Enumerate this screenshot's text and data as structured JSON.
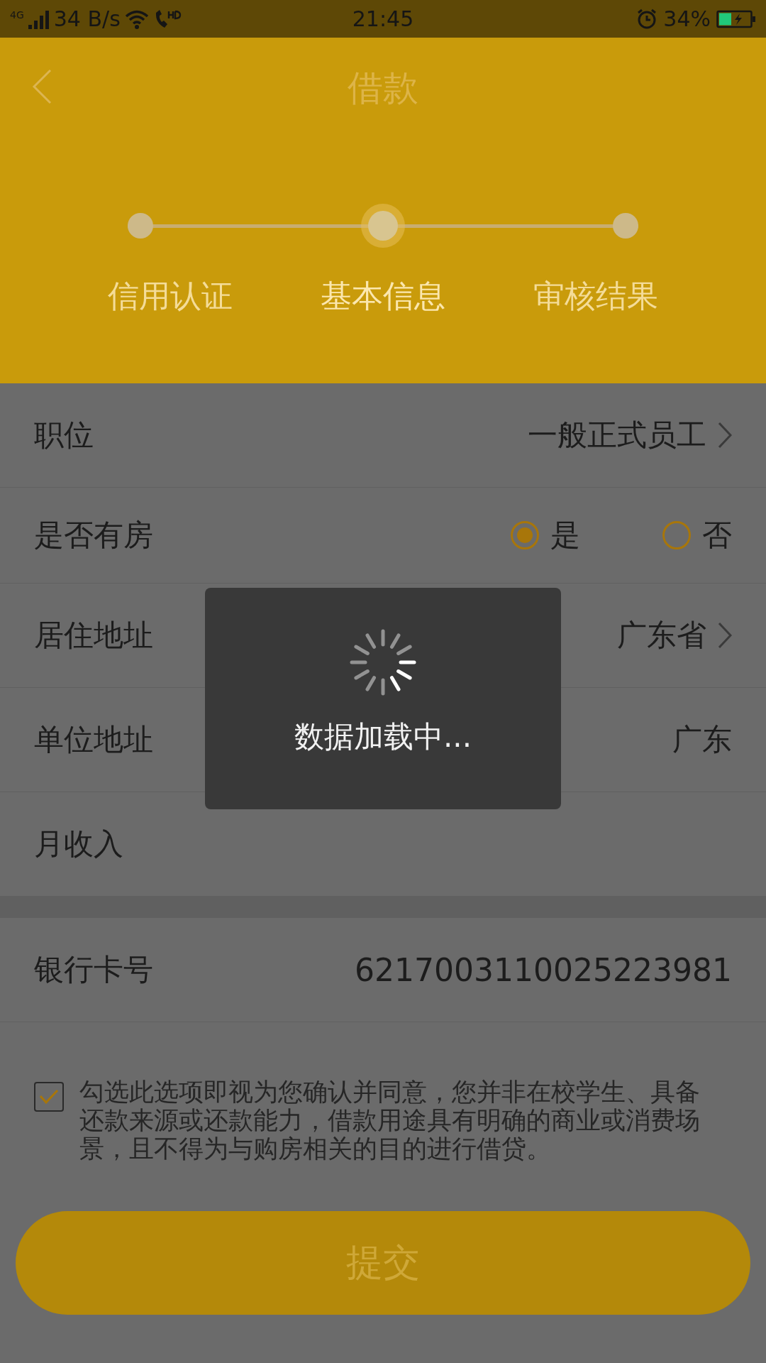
{
  "status_bar": {
    "network": "4G",
    "speed": "34 B/s",
    "time": "21:45",
    "battery": "34%"
  },
  "header": {
    "title": "借款"
  },
  "steps": [
    {
      "label": "信用认证",
      "selected": false
    },
    {
      "label": "基本信息",
      "selected": true
    },
    {
      "label": "审核结果",
      "selected": false
    }
  ],
  "form": [
    {
      "kind": "select",
      "label": "职位",
      "value": "一般正式员工"
    },
    {
      "kind": "radio",
      "label": "是否有房",
      "options": [
        {
          "label": "是",
          "selected": true
        },
        {
          "label": "否",
          "selected": false
        }
      ]
    },
    {
      "kind": "select",
      "label": "居住地址",
      "value": "广东省"
    },
    {
      "kind": "text",
      "label": "单位地址",
      "value": "广东"
    },
    {
      "kind": "text",
      "label": "月收入"
    }
  ],
  "bank_card": {
    "label": "银行卡号",
    "value": "6217003110025223981"
  },
  "agreement": {
    "checked": true,
    "text": "勾选此选项即视为您确认并同意，您并非在校学生、具备还款来源或还款能力，借款用途具有明确的商业或消费场景，且不得为与购房相关的目的进行借贷。"
  },
  "submit": "提交",
  "loading": {
    "text": "数据加载中..."
  }
}
